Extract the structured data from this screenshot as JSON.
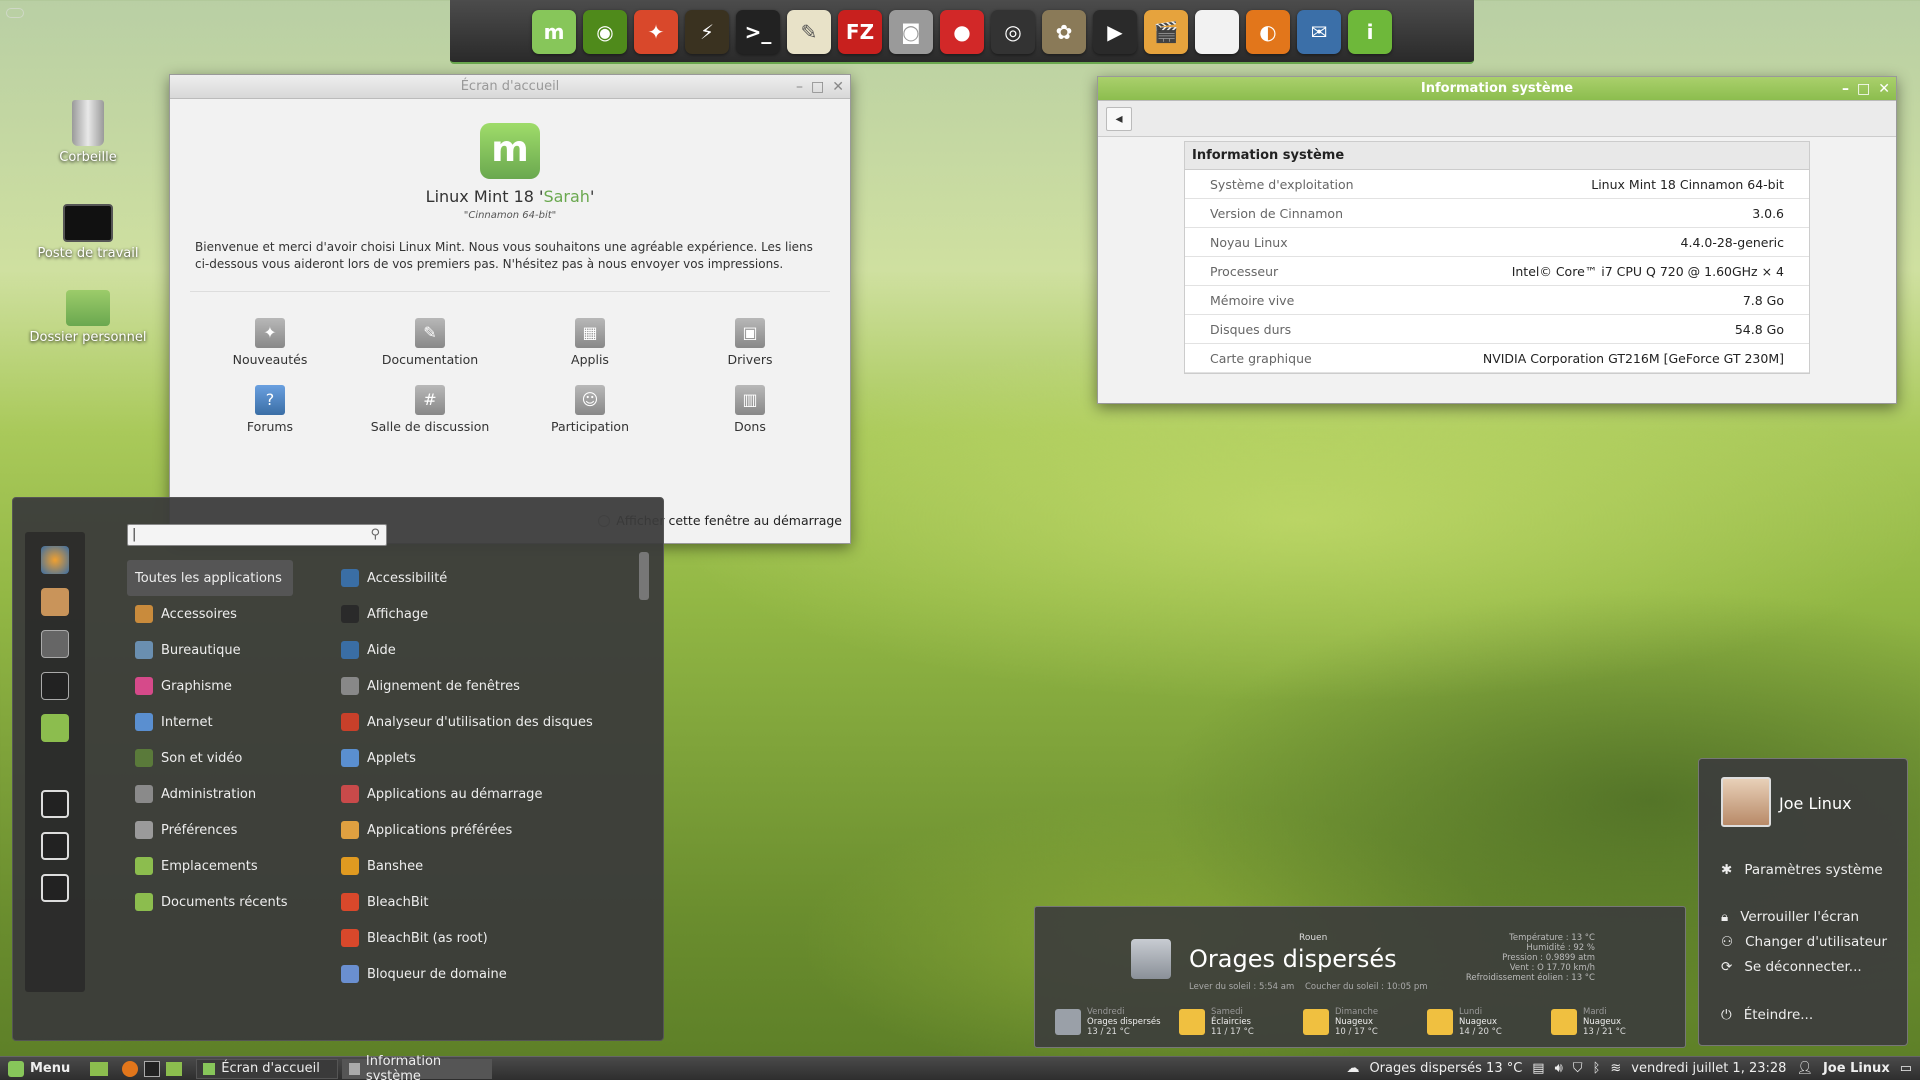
{
  "dock": {
    "items": [
      {
        "name": "mint-menu-icon",
        "color": "#87c65a",
        "glyph": "m"
      },
      {
        "name": "nvidia-settings-icon",
        "color": "#4f8a1b",
        "glyph": "◉"
      },
      {
        "name": "bleachbit-icon",
        "color": "#d9482b",
        "glyph": "✦"
      },
      {
        "name": "system-monitor-icon",
        "color": "#3a3220",
        "glyph": "⚡"
      },
      {
        "name": "terminal-icon",
        "color": "#222222",
        "glyph": ">_"
      },
      {
        "name": "text-editor-icon",
        "color": "#e8e2c8",
        "glyph": "✎"
      },
      {
        "name": "filezilla-icon",
        "color": "#c8201e",
        "glyph": "FZ"
      },
      {
        "name": "screenshot-icon",
        "color": "#9a9a9a",
        "glyph": "◙"
      },
      {
        "name": "disc-burner-icon",
        "color": "#d22828",
        "glyph": "●"
      },
      {
        "name": "webcam-icon",
        "color": "#333333",
        "glyph": "◎"
      },
      {
        "name": "gimp-icon",
        "color": "#8a7a58",
        "glyph": "✿"
      },
      {
        "name": "video-player-icon",
        "color": "#2a2a2a",
        "glyph": "▶"
      },
      {
        "name": "video-editor-icon",
        "color": "#e6a33d",
        "glyph": "🎬"
      },
      {
        "name": "document-icon",
        "color": "#f2f2f2",
        "glyph": ""
      },
      {
        "name": "firefox-icon",
        "color": "#e2761b",
        "glyph": "◐"
      },
      {
        "name": "thunderbird-icon",
        "color": "#3b6fa8",
        "glyph": "✉"
      },
      {
        "name": "info-icon",
        "color": "#6eb83a",
        "glyph": "i"
      }
    ]
  },
  "desktop": {
    "trash": "Corbeille",
    "computer": "Poste de travail",
    "home": "Dossier personnel"
  },
  "welcome": {
    "title": "Écran d'accueil",
    "heading_prefix": "Linux Mint 18 '",
    "heading_name": "Sarah",
    "heading_suffix": "'",
    "edition": "\"Cinnamon 64-bit\"",
    "intro": "Bienvenue et merci d'avoir choisi Linux Mint. Nous vous souhaitons une agréable expérience. Les liens ci-dessous vous aideront lors de vos premiers pas. N'hésitez pas à nous envoyer vos impressions.",
    "items": [
      "Nouveautés",
      "Documentation",
      "Applis",
      "Drivers",
      "Forums",
      "Salle de discussion",
      "Participation",
      "Dons"
    ],
    "startup_label": "Afficher cette fenêtre au démarrage"
  },
  "sysinfo": {
    "title": "Information système",
    "back": "◂",
    "table_header": "Information système",
    "rows": [
      {
        "k": "Système d'exploitation",
        "v": "Linux Mint 18 Cinnamon 64-bit"
      },
      {
        "k": "Version de Cinnamon",
        "v": "3.0.6"
      },
      {
        "k": "Noyau Linux",
        "v": "4.4.0-28-generic"
      },
      {
        "k": "Processeur",
        "v": "Intel© Core™ i7 CPU       Q 720  @ 1.60GHz × 4"
      },
      {
        "k": "Mémoire vive",
        "v": "7.8 Go"
      },
      {
        "k": "Disques durs",
        "v": "54.8 Go"
      },
      {
        "k": "Carte graphique",
        "v": "NVIDIA Corporation GT216M [GeForce GT 230M]"
      }
    ]
  },
  "menu": {
    "search_value": "|",
    "categories": [
      {
        "label": "Toutes les applications",
        "color": "",
        "selected": true
      },
      {
        "label": "Accessoires",
        "color": "#c98b3c"
      },
      {
        "label": "Bureautique",
        "color": "#6a8fb0"
      },
      {
        "label": "Graphisme",
        "color": "#d64a8a"
      },
      {
        "label": "Internet",
        "color": "#5a8fd0"
      },
      {
        "label": "Son et vidéo",
        "color": "#5a7a3a"
      },
      {
        "label": "Administration",
        "color": "#8a8a8a"
      },
      {
        "label": "Préférences",
        "color": "#9a9a9a"
      },
      {
        "label": "Emplacements",
        "color": "#8cbd4e"
      },
      {
        "label": "Documents récents",
        "color": "#8cbd4e"
      }
    ],
    "apps": [
      {
        "label": "Accessibilité",
        "color": "#3a6ea5"
      },
      {
        "label": "Affichage",
        "color": "#2a2a2a"
      },
      {
        "label": "Aide",
        "color": "#3a6ea5"
      },
      {
        "label": "Alignement de fenêtres",
        "color": "#888888"
      },
      {
        "label": "Analyseur d'utilisation des disques",
        "color": "#c8402a"
      },
      {
        "label": "Applets",
        "color": "#5a8fd0"
      },
      {
        "label": "Applications au démarrage",
        "color": "#c84a4a"
      },
      {
        "label": "Applications préférées",
        "color": "#e0a040"
      },
      {
        "label": "Banshee",
        "color": "#e09a20"
      },
      {
        "label": "BleachBit",
        "color": "#d9482b"
      },
      {
        "label": "BleachBit (as root)",
        "color": "#d9482b"
      },
      {
        "label": "Bloqueur de domaine",
        "color": "#6a8fd0"
      }
    ]
  },
  "weather": {
    "city": "Rouen",
    "condition": "Orages dispersés",
    "sunrise": "Lever du soleil : 5:54 am",
    "sunset": "Coucher du soleil : 10:05 pm",
    "details": [
      "Température : 13 °C",
      "Humidité : 92 %",
      "Pression : 0.9899 atm",
      "Vent : O 17.70 km/h",
      "Refroidissement éolien : 13 °C"
    ],
    "forecast": [
      {
        "day": "Vendredi",
        "cond": "Orages dispersés",
        "temp": "13 / 21 °C",
        "color": "#9aa0a8"
      },
      {
        "day": "Samedi",
        "cond": "Éclaircies",
        "temp": "11 / 17 °C",
        "color": "#f0c040"
      },
      {
        "day": "Dimanche",
        "cond": "Nuageux",
        "temp": "10 / 17 °C",
        "color": "#f0c040"
      },
      {
        "day": "Lundi",
        "cond": "Nuageux",
        "temp": "14 / 20 °C",
        "color": "#f0c040"
      },
      {
        "day": "Mardi",
        "cond": "Nuageux",
        "temp": "13 / 21 °C",
        "color": "#f0c040"
      }
    ]
  },
  "user": {
    "name": "Joe Linux",
    "settings": "Paramètres système",
    "lock": "Verrouiller l'écran",
    "switch": "Changer d'utilisateur",
    "logout": "Se déconnecter...",
    "shutdown": "Éteindre..."
  },
  "panel": {
    "menu_label": "Menu",
    "tasks": [
      "Écran d'accueil",
      "Information système"
    ],
    "weather": "Orages dispersés 13 °C",
    "clock": "vendredi juillet  1, 23:28",
    "user": "Joe Linux"
  }
}
